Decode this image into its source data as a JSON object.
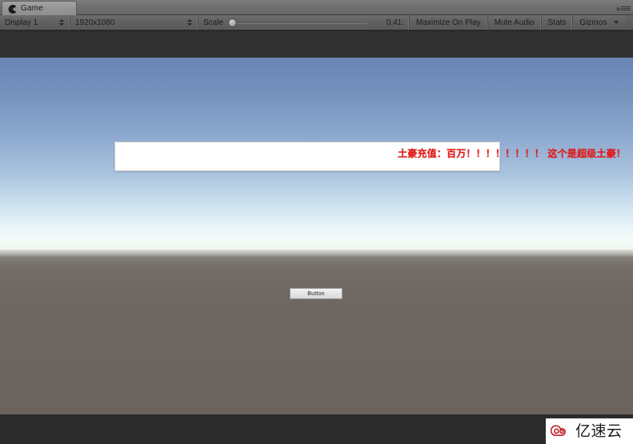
{
  "window": {
    "tab_label": "Game",
    "tab_icon": "game-pacman-icon",
    "menu_icon": "window-options-icon"
  },
  "toolbar": {
    "display_value": "Display 1",
    "resolution_value": "1920x1080",
    "scale_label": "Scale",
    "scale_value": "0.41:",
    "maximize_on_play_label": "Maximize On Play",
    "mute_audio_label": "Mute Audio",
    "stats_label": "Stats",
    "gizmos_label": "Gizmos"
  },
  "game": {
    "message_text": "土豪充值：百万！！！！！！！！ 这个是超级土豪！",
    "message_color": "#e21b1b",
    "button_label": "Button",
    "sky_top_color": "#6a85b4",
    "sky_bottom_color": "#f4fbf8",
    "ground_color": "#6c6560",
    "letterbox_color": "#2b2b2b"
  },
  "watermark": {
    "text": "亿速云",
    "logo_color": "#c1272d"
  }
}
